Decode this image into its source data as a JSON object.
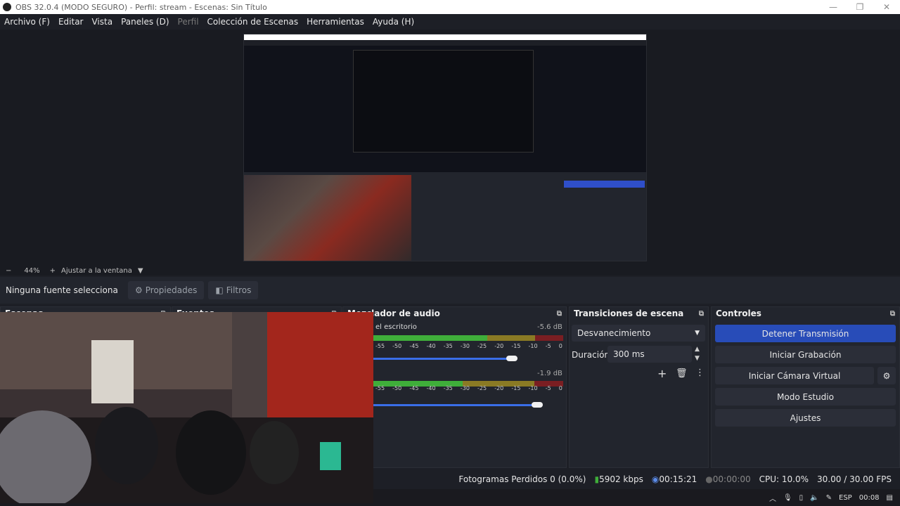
{
  "window": {
    "title": "OBS 32.0.4 (MODO SEGURO) - Perfil: stream - Escenas: Sin Título",
    "controls": [
      "—",
      "❐",
      "✕"
    ]
  },
  "menu": [
    {
      "label": "Archivo (F)",
      "disabled": false
    },
    {
      "label": "Editar",
      "disabled": false
    },
    {
      "label": "Vista",
      "disabled": false
    },
    {
      "label": "Paneles (D)",
      "disabled": false
    },
    {
      "label": "Perfil",
      "disabled": true
    },
    {
      "label": "Colección de Escenas",
      "disabled": false
    },
    {
      "label": "Herramientas",
      "disabled": false
    },
    {
      "label": "Ayuda (H)",
      "disabled": false
    }
  ],
  "zoom": {
    "minus": "−",
    "value": "44%",
    "plus": "+",
    "fit_label": "Ajustar a la ventana"
  },
  "source_bar": {
    "no_selection": "Ninguna fuente selecciona",
    "properties": "Propiedades",
    "filters": "Filtros"
  },
  "docks": {
    "scenes": "Escenas",
    "sources": "Fuentes",
    "mixer": "Mezclador de audio",
    "transitions": "Transiciones de escena",
    "controls": "Controles"
  },
  "mixer": {
    "tracks": [
      {
        "name": "el escritorio",
        "db": "-5.6 dB",
        "volume": 0.73
      },
      {
        "name": "",
        "db": "-1.9 dB",
        "volume": 0.86
      }
    ],
    "scale": [
      "-55",
      "-50",
      "-45",
      "-40",
      "-35",
      "-30",
      "-25",
      "-20",
      "-15",
      "-10",
      "-5",
      "0"
    ]
  },
  "transitions": {
    "selected": "Desvanecimiento",
    "duration_label": "Duración",
    "duration_value": "300 ms"
  },
  "controls": {
    "stop_stream": "Detener Transmisión",
    "start_recording": "Iniciar Grabación",
    "virtual_camera": "Iniciar Cámara Virtual",
    "studio_mode": "Modo Estudio",
    "settings": "Ajustes"
  },
  "status": {
    "dropped": "Fotogramas Perdidos 0 (0.0%)",
    "bitrate": "5902 kbps",
    "stream_time": "00:15:21",
    "rec_time": "00:00:00",
    "cpu": "CPU: 10.0%",
    "fps": "30.00 / 30.00 FPS"
  },
  "taskbar": {
    "lang": "ESP",
    "time": "00:08"
  },
  "colors": {
    "accent": "#284cb8",
    "meter_green": "#3fae3a",
    "meter_yellow": "#b8a32c",
    "meter_red": "#a32525"
  }
}
